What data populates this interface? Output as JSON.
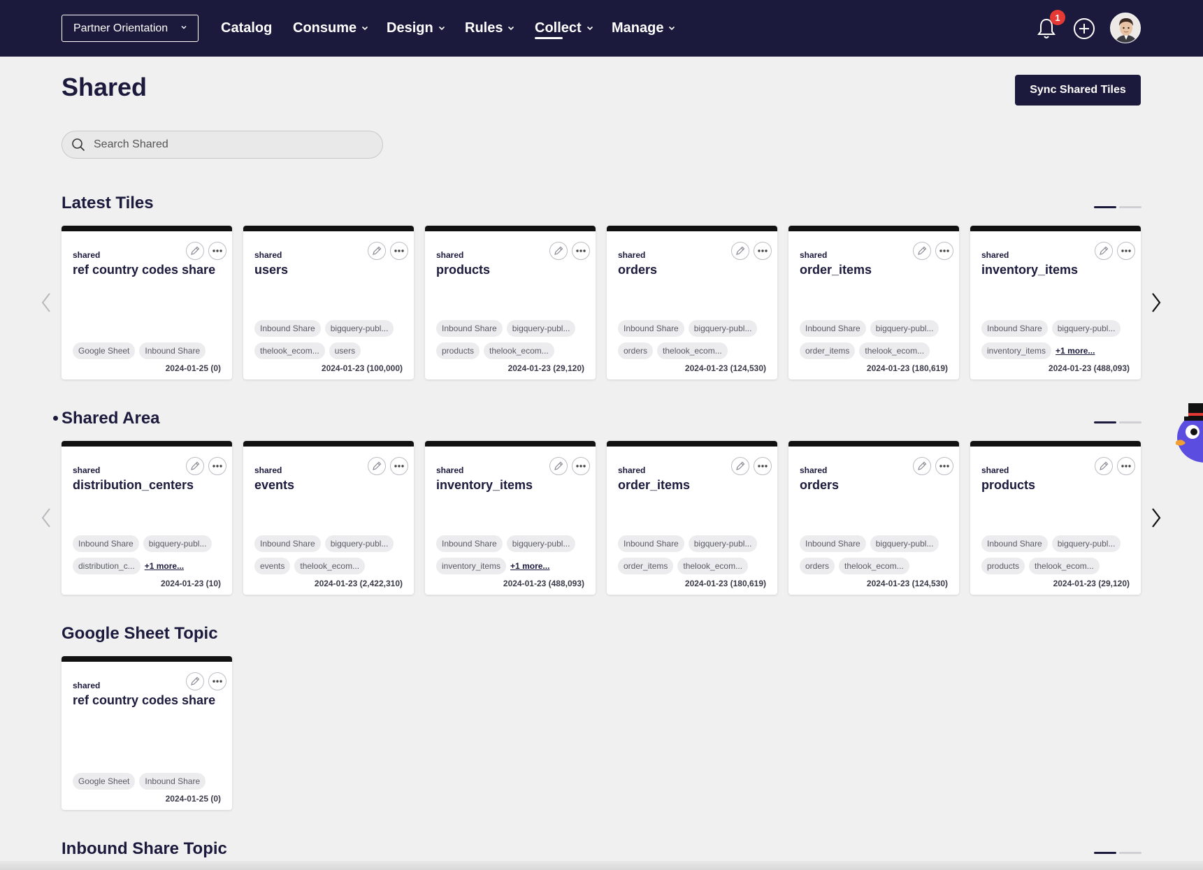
{
  "nav": {
    "org": "Partner Orientation",
    "items": [
      {
        "label": "Catalog",
        "dropdown": false
      },
      {
        "label": "Consume",
        "dropdown": true
      },
      {
        "label": "Design",
        "dropdown": true
      },
      {
        "label": "Rules",
        "dropdown": true
      },
      {
        "label": "Collect",
        "dropdown": true
      },
      {
        "label": "Manage",
        "dropdown": true
      }
    ],
    "active": "Collect",
    "notification_count": "1"
  },
  "page": {
    "title": "Shared",
    "sync_button": "Sync Shared Tiles",
    "search_placeholder": "Search Shared"
  },
  "sections": [
    {
      "title": "Latest Tiles",
      "tiles": [
        {
          "kind": "shared",
          "name": "ref country codes share",
          "tags": [
            "Google Sheet",
            "Inbound Share"
          ],
          "more": "",
          "date": "2024-01-25 (0)"
        },
        {
          "kind": "shared",
          "name": "users",
          "tags": [
            "Inbound Share",
            "bigquery-publ...",
            "thelook_ecom...",
            "users"
          ],
          "more": "",
          "date": "2024-01-23 (100,000)"
        },
        {
          "kind": "shared",
          "name": "products",
          "tags": [
            "Inbound Share",
            "bigquery-publ...",
            "products",
            "thelook_ecom..."
          ],
          "more": "",
          "date": "2024-01-23 (29,120)"
        },
        {
          "kind": "shared",
          "name": "orders",
          "tags": [
            "Inbound Share",
            "bigquery-publ...",
            "orders",
            "thelook_ecom..."
          ],
          "more": "",
          "date": "2024-01-23 (124,530)"
        },
        {
          "kind": "shared",
          "name": "order_items",
          "tags": [
            "Inbound Share",
            "bigquery-publ...",
            "order_items",
            "thelook_ecom..."
          ],
          "more": "",
          "date": "2024-01-23 (180,619)"
        },
        {
          "kind": "shared",
          "name": "inventory_items",
          "tags": [
            "Inbound Share",
            "bigquery-publ...",
            "inventory_items"
          ],
          "more": "+1 more...",
          "date": "2024-01-23 (488,093)"
        }
      ]
    },
    {
      "title": "Shared Area",
      "tiles": [
        {
          "kind": "shared",
          "name": "distribution_centers",
          "tags": [
            "Inbound Share",
            "bigquery-publ...",
            "distribution_c..."
          ],
          "more": "+1 more...",
          "date": "2024-01-23 (10)"
        },
        {
          "kind": "shared",
          "name": "events",
          "tags": [
            "Inbound Share",
            "bigquery-publ...",
            "events",
            "thelook_ecom..."
          ],
          "more": "",
          "date": "2024-01-23 (2,422,310)"
        },
        {
          "kind": "shared",
          "name": "inventory_items",
          "tags": [
            "Inbound Share",
            "bigquery-publ...",
            "inventory_items"
          ],
          "more": "+1 more...",
          "date": "2024-01-23 (488,093)"
        },
        {
          "kind": "shared",
          "name": "order_items",
          "tags": [
            "Inbound Share",
            "bigquery-publ...",
            "order_items",
            "thelook_ecom..."
          ],
          "more": "",
          "date": "2024-01-23 (180,619)"
        },
        {
          "kind": "shared",
          "name": "orders",
          "tags": [
            "Inbound Share",
            "bigquery-publ...",
            "orders",
            "thelook_ecom..."
          ],
          "more": "",
          "date": "2024-01-23 (124,530)"
        },
        {
          "kind": "shared",
          "name": "products",
          "tags": [
            "Inbound Share",
            "bigquery-publ...",
            "products",
            "thelook_ecom..."
          ],
          "more": "",
          "date": "2024-01-23 (29,120)"
        }
      ]
    },
    {
      "title": "Google Sheet Topic",
      "tiles": [
        {
          "kind": "shared",
          "name": "ref country codes share",
          "tags": [
            "Google Sheet",
            "Inbound Share"
          ],
          "more": "",
          "date": "2024-01-25 (0)"
        }
      ]
    },
    {
      "title": "Inbound Share Topic",
      "tiles": []
    }
  ],
  "colors": {
    "nav_bg": "#1b1a3c",
    "badge": "#e53935",
    "card_top": "#111111"
  }
}
